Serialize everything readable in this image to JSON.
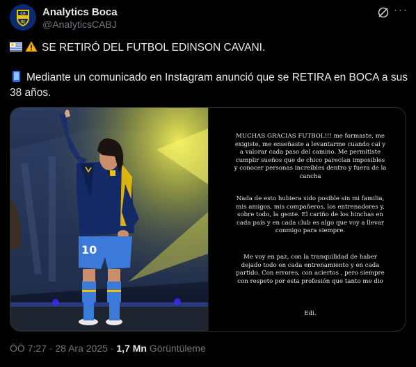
{
  "author": {
    "name": "Analytics Boca",
    "handle": "@AnaIyticsCABJ",
    "avatar_icon": "boca-crest-icon"
  },
  "header_icons": {
    "grok": "grok-icon",
    "more": "···"
  },
  "tweet": {
    "line1": "SE RETIRÓ DEL FUTBOL EDINSON CAVANI.",
    "line1_icons": [
      "uruguay-flag-icon",
      "warning-icon"
    ],
    "line2": "Mediante un comunicado en Instagram anunció que se RETIRA en BOCA a sus",
    "line2_icon": "mobile-phone-icon",
    "line3": "38 años."
  },
  "media": {
    "photo_description_icon": "cavani-photo",
    "shirt_number": "10",
    "story": {
      "p1": "MUCHAS GRACIAS FUTBOL!!! me formaste,  me exigiste, me enseñaste a levantarme cuando caí y a valorar cada paso del camino. Me permitiste cumplir sueños que de chico parecían imposibles y conocer personas increíbles dentro y fuera de la cancha",
      "p2": "Nada de esto hubiera sido posible sin mi familia, mis amigos, mis compañeros, los entrenadores  y, sobre todo,  la gente. El cariño de los hinchas en cada país y en cada club es algo que voy a llevar conmigo para siempre.",
      "p3": "Me voy en paz, con la tranquilidad de haber dejado todo en cada entrenamiento y en cada partido. Con errores, con aciertos ,  pero siempre con respeto por esta profesión que tanto me dio",
      "p4": "Edi."
    }
  },
  "meta": {
    "time": "ÖÖ 7:27",
    "date": "28 Ara 2025",
    "separator": "·",
    "views_count": "1,7 Mn",
    "views_label": "Görüntüleme"
  },
  "colors": {
    "background": "#000000",
    "text": "#e7e9ea",
    "muted": "#71767b",
    "border": "#2f3336",
    "boca_blue": "#0a2a6e",
    "boca_yellow": "#f2c200"
  }
}
